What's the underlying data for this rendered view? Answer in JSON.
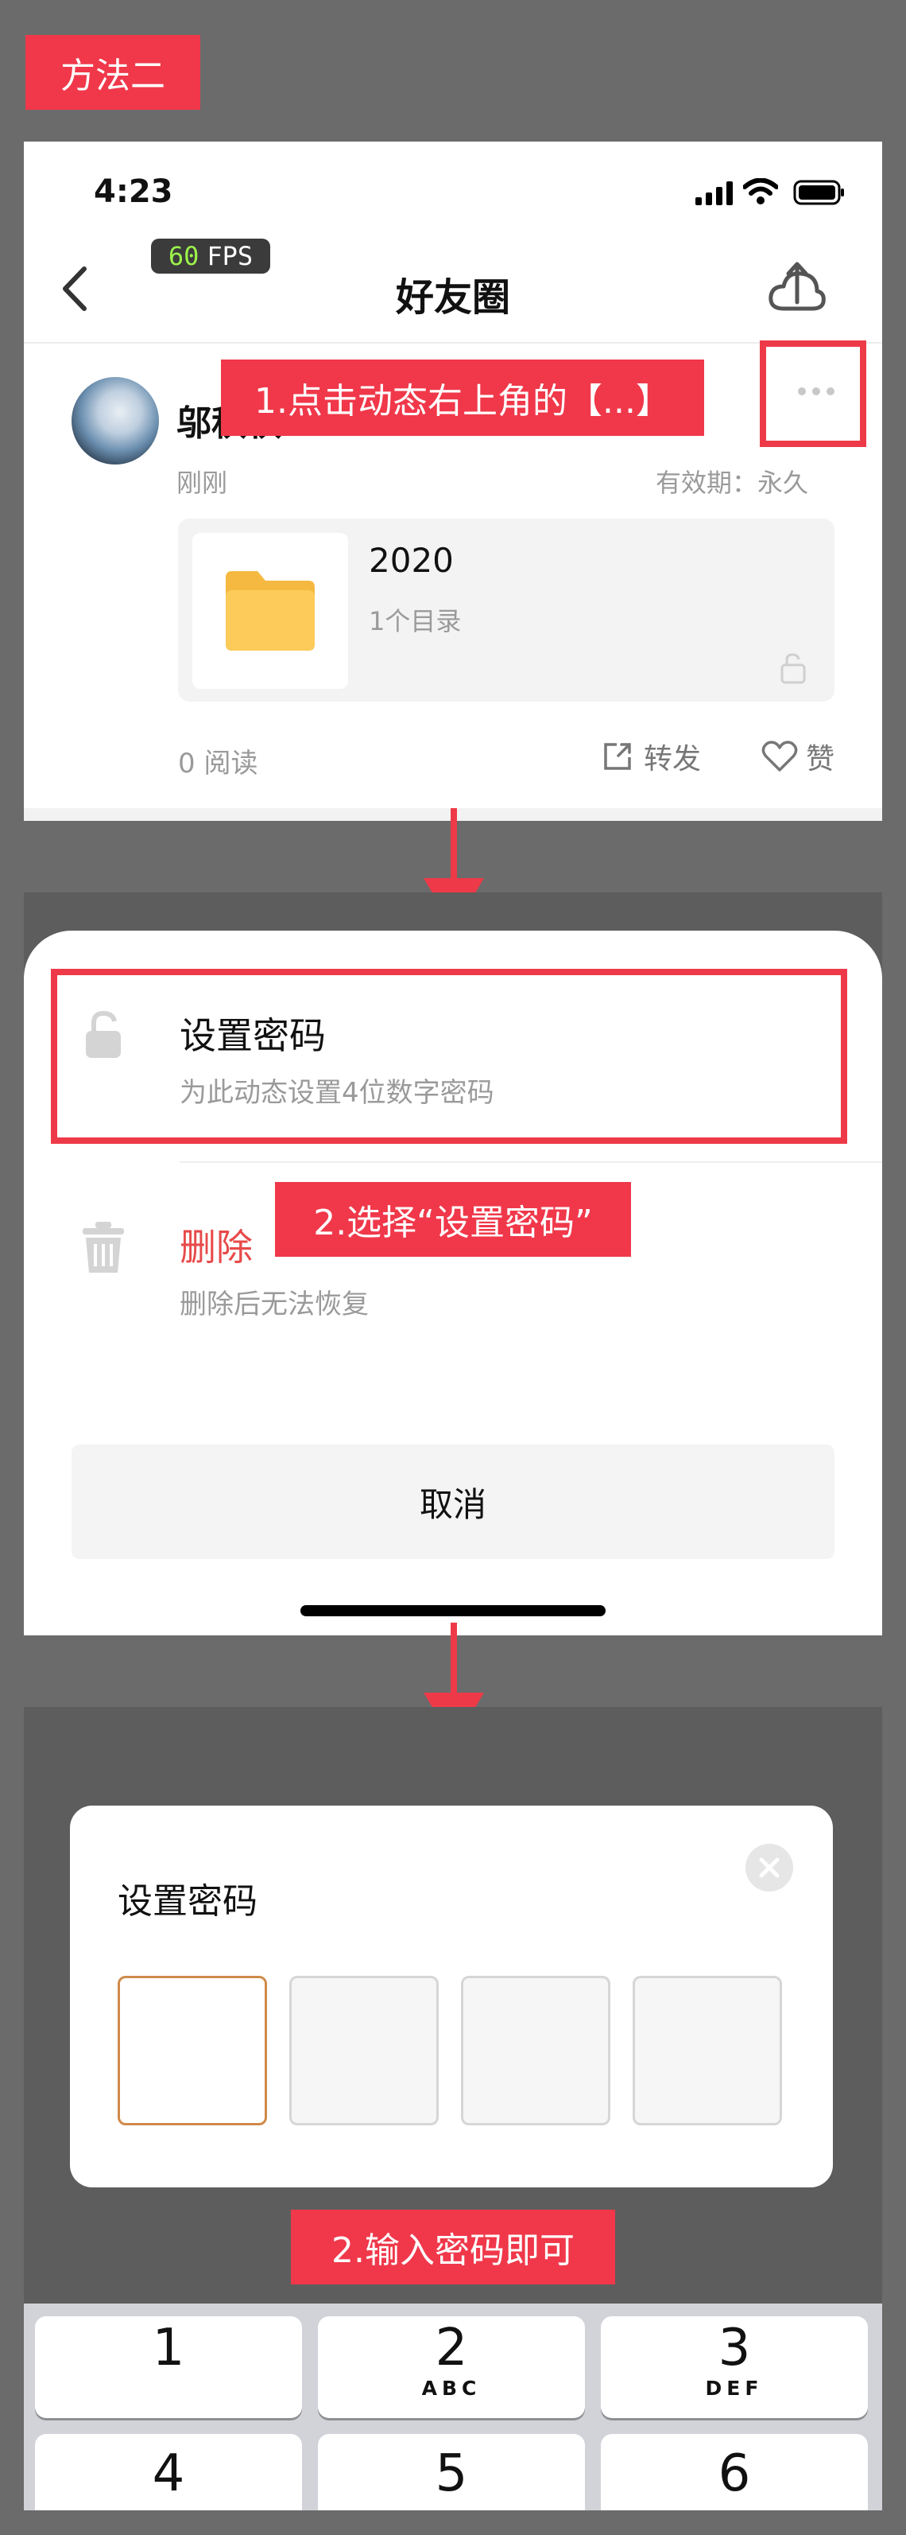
{
  "method_label": "方法二",
  "panel1": {
    "time": "4:23",
    "fps": {
      "num": "60",
      "unit": "FPS"
    },
    "title": "好友圈",
    "post": {
      "author": "邬秋秋",
      "time": "刚刚",
      "validity": "有效期：永久",
      "folder_name": "2020",
      "folder_meta": "1个目录",
      "reads": "0 阅读",
      "forward": "转发",
      "like": "赞"
    },
    "callout": "1.点击动态右上角的【...】"
  },
  "panel2": {
    "set_password": {
      "title": "设置密码",
      "desc": "为此动态设置4位数字密码"
    },
    "delete": {
      "title": "删除",
      "desc": "删除后无法恢复"
    },
    "cancel": "取消",
    "callout": "2.选择“设置密码”"
  },
  "panel3": {
    "dialog_title": "设置密码",
    "callout": "2.输入密码即可",
    "keys": [
      {
        "num": "1",
        "letters": ""
      },
      {
        "num": "2",
        "letters": "ABC"
      },
      {
        "num": "3",
        "letters": "DEF"
      },
      {
        "num": "4",
        "letters": ""
      },
      {
        "num": "5",
        "letters": ""
      },
      {
        "num": "6",
        "letters": ""
      }
    ]
  },
  "colors": {
    "accent": "#ee3a48",
    "folder": "#fccb59",
    "delete_text": "#e84a4a"
  }
}
